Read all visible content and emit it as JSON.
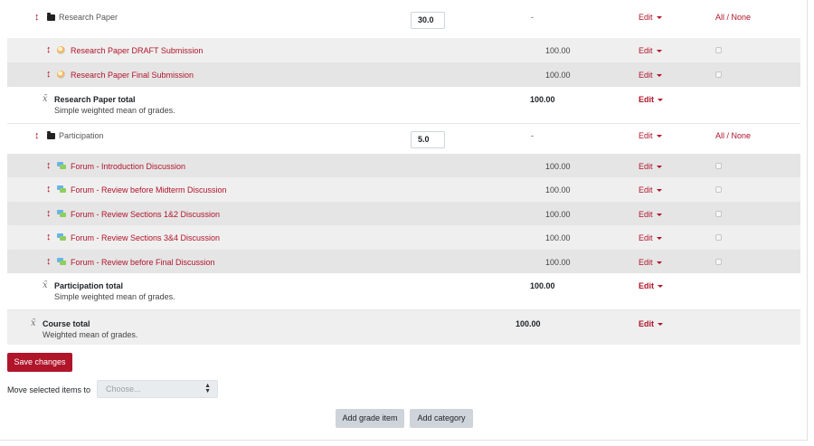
{
  "categories": [
    {
      "name": "Research Paper",
      "weight": "30.0",
      "range": "-",
      "edit": "Edit",
      "select": "All / None",
      "items": [
        {
          "name": "Research Paper DRAFT Submission",
          "max": "100.00",
          "edit": "Edit",
          "icon": "assignment-icon"
        },
        {
          "name": "Research Paper Final Submission",
          "max": "100.00",
          "edit": "Edit",
          "icon": "assignment-icon"
        }
      ],
      "total": {
        "name": "Research Paper total",
        "desc": "Simple weighted mean of grades.",
        "max": "100.00",
        "edit": "Edit"
      }
    },
    {
      "name": "Participation",
      "weight": "5.0",
      "range": "-",
      "edit": "Edit",
      "select": "All / None",
      "items": [
        {
          "name": "Forum - Introduction Discussion",
          "max": "100.00",
          "edit": "Edit",
          "icon": "forum-icon"
        },
        {
          "name": "Forum - Review before Midterm Discussion",
          "max": "100.00",
          "edit": "Edit",
          "icon": "forum-icon"
        },
        {
          "name": "Forum - Review Sections 1&2 Discussion",
          "max": "100.00",
          "edit": "Edit",
          "icon": "forum-icon"
        },
        {
          "name": "Forum - Review Sections 3&4 Discussion",
          "max": "100.00",
          "edit": "Edit",
          "icon": "forum-icon"
        },
        {
          "name": "Forum - Review before Final Discussion",
          "max": "100.00",
          "edit": "Edit",
          "icon": "forum-icon"
        }
      ],
      "total": {
        "name": "Participation total",
        "desc": "Simple weighted mean of grades.",
        "max": "100.00",
        "edit": "Edit"
      }
    }
  ],
  "course_total": {
    "name": "Course total",
    "desc": "Weighted mean of grades.",
    "max": "100.00",
    "edit": "Edit"
  },
  "actions": {
    "save": "Save changes",
    "move_label": "Move selected items to",
    "move_placeholder": "Choose...",
    "add_item": "Add grade item",
    "add_category": "Add category"
  },
  "colors": {
    "accent": "#b0152a",
    "row_alt": "#e5e5e5",
    "row_light": "#efefef"
  }
}
